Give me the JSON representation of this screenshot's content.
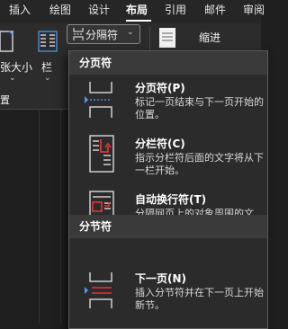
{
  "tabs": [
    "插入",
    "绘图",
    "设计",
    "布局",
    "引用",
    "邮件",
    "审阅"
  ],
  "active_tab": "布局",
  "ribbon": {
    "size_label": "张大小",
    "columns_label": "栏",
    "breaks_label": "分隔符",
    "indent_label": "缩进",
    "group_fragment": "置"
  },
  "menu": {
    "page_breaks_header": "分页符",
    "section_breaks_header": "分节符",
    "items": [
      {
        "title": "分页符(P)",
        "desc": "标记一页结束与下一页开始的\n位置。",
        "icon": "page-break-icon"
      },
      {
        "title": "分栏符(C)",
        "desc": "指示分栏符后面的文字将从下\n一栏开始。",
        "icon": "column-break-icon"
      },
      {
        "title": "自动换行符(T)",
        "desc": "分隔网页上的对象周围的文\n字，如分隔题注文字与正文。",
        "icon": "text-wrapping-break-icon"
      },
      {
        "title": "下一页(N)",
        "desc": "插入分节符并在下一页上开始\n新节。",
        "icon": "next-page-section-icon"
      }
    ]
  },
  "colors": {
    "accent_blue": "#4a9ff5",
    "accent_red": "#e2343a"
  }
}
